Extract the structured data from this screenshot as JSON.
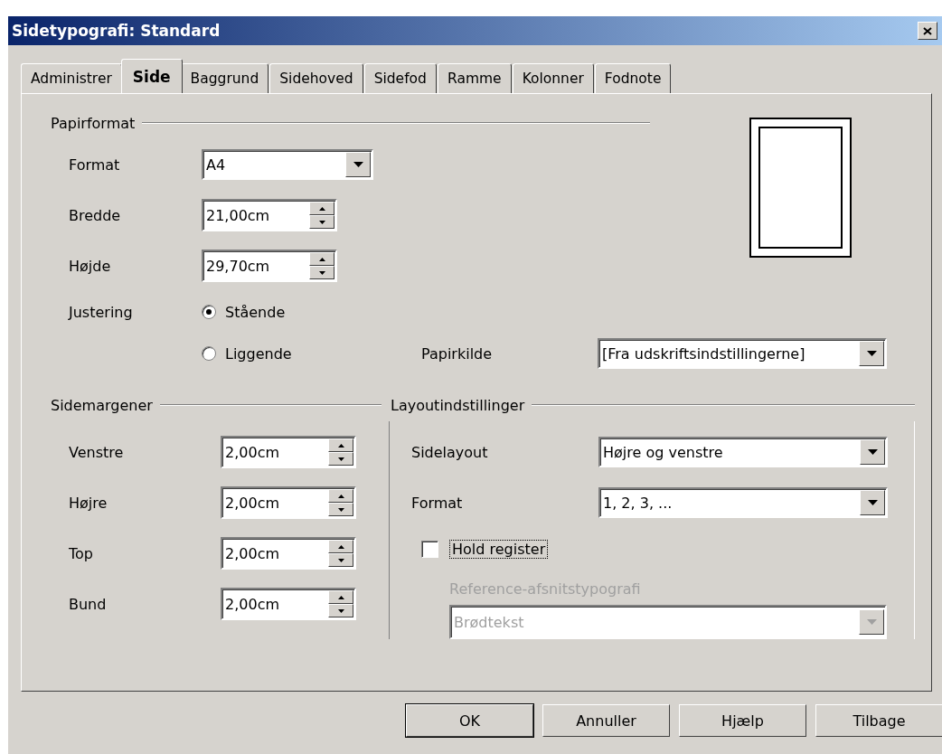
{
  "window": {
    "title": "Sidetypografi: Standard"
  },
  "tabs": [
    {
      "label": "Administrer",
      "selected": false
    },
    {
      "label": "Side",
      "selected": true
    },
    {
      "label": "Baggrund",
      "selected": false
    },
    {
      "label": "Sidehoved",
      "selected": false
    },
    {
      "label": "Sidefod",
      "selected": false
    },
    {
      "label": "Ramme",
      "selected": false
    },
    {
      "label": "Kolonner",
      "selected": false
    },
    {
      "label": "Fodnote",
      "selected": false
    }
  ],
  "paper_format": {
    "heading": "Papirformat",
    "fields": [
      {
        "label": "Format",
        "kind": "dropdown",
        "value": "A4"
      },
      {
        "label": "Bredde",
        "kind": "spin",
        "value": "21,00cm"
      },
      {
        "label": "Højde",
        "kind": "spin",
        "value": "29,70cm"
      }
    ],
    "orientation": {
      "label": "Justering",
      "options": [
        {
          "label": "Stående",
          "selected": true
        },
        {
          "label": "Liggende",
          "selected": false
        }
      ]
    },
    "paper_source": {
      "label": "Papirkilde",
      "value": "[Fra udskriftsindstillingerne]"
    }
  },
  "margins": {
    "heading": "Sidemargener",
    "fields": [
      {
        "label": "Venstre",
        "kind": "spin",
        "value": "2,00cm"
      },
      {
        "label": "Højre",
        "kind": "spin",
        "value": "2,00cm"
      },
      {
        "label": "Top",
        "kind": "spin",
        "value": "2,00cm"
      },
      {
        "label": "Bund",
        "kind": "spin",
        "value": "2,00cm"
      }
    ]
  },
  "layout": {
    "heading": "Layoutindstillinger",
    "fields": [
      {
        "label": "Sidelayout",
        "kind": "dropdown",
        "value": "Højre og venstre"
      },
      {
        "label": "Format",
        "kind": "dropdown",
        "value": "1, 2, 3, ..."
      }
    ],
    "hold_register": {
      "label": "Hold register",
      "checked": false
    },
    "reference": {
      "label": "Reference-afsnitstypografi",
      "value": "Brødtekst",
      "disabled": true
    }
  },
  "buttons": [
    {
      "label": "OK",
      "default": true
    },
    {
      "label": "Annuller",
      "default": false
    },
    {
      "label": "Hjælp",
      "default": false
    },
    {
      "label": "Tilbage",
      "default": false
    }
  ]
}
